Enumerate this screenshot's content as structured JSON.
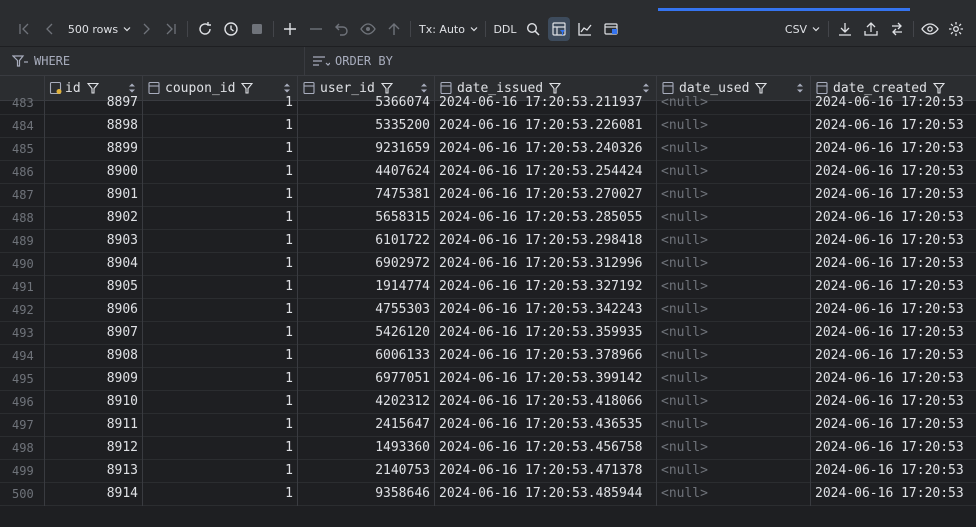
{
  "toolbar": {
    "rows_label": "500 rows",
    "tx_label": "Tx: Auto",
    "ddl_label": "DDL",
    "export_format": "CSV"
  },
  "filters": {
    "where_label": "WHERE",
    "order_by_label": "ORDER BY"
  },
  "columns": [
    {
      "name": "id"
    },
    {
      "name": "coupon_id"
    },
    {
      "name": "user_id"
    },
    {
      "name": "date_issued"
    },
    {
      "name": "date_used"
    },
    {
      "name": "date_created"
    }
  ],
  "rows": [
    {
      "num": "483",
      "id": "8897",
      "coupon_id": "1",
      "user_id": "5366074",
      "date_issued": "2024-06-16 17:20:53.211937",
      "date_used": "<null>",
      "date_created": "2024-06-16 17:20:53"
    },
    {
      "num": "484",
      "id": "8898",
      "coupon_id": "1",
      "user_id": "5335200",
      "date_issued": "2024-06-16 17:20:53.226081",
      "date_used": "<null>",
      "date_created": "2024-06-16 17:20:53"
    },
    {
      "num": "485",
      "id": "8899",
      "coupon_id": "1",
      "user_id": "9231659",
      "date_issued": "2024-06-16 17:20:53.240326",
      "date_used": "<null>",
      "date_created": "2024-06-16 17:20:53"
    },
    {
      "num": "486",
      "id": "8900",
      "coupon_id": "1",
      "user_id": "4407624",
      "date_issued": "2024-06-16 17:20:53.254424",
      "date_used": "<null>",
      "date_created": "2024-06-16 17:20:53"
    },
    {
      "num": "487",
      "id": "8901",
      "coupon_id": "1",
      "user_id": "7475381",
      "date_issued": "2024-06-16 17:20:53.270027",
      "date_used": "<null>",
      "date_created": "2024-06-16 17:20:53"
    },
    {
      "num": "488",
      "id": "8902",
      "coupon_id": "1",
      "user_id": "5658315",
      "date_issued": "2024-06-16 17:20:53.285055",
      "date_used": "<null>",
      "date_created": "2024-06-16 17:20:53"
    },
    {
      "num": "489",
      "id": "8903",
      "coupon_id": "1",
      "user_id": "6101722",
      "date_issued": "2024-06-16 17:20:53.298418",
      "date_used": "<null>",
      "date_created": "2024-06-16 17:20:53"
    },
    {
      "num": "490",
      "id": "8904",
      "coupon_id": "1",
      "user_id": "6902972",
      "date_issued": "2024-06-16 17:20:53.312996",
      "date_used": "<null>",
      "date_created": "2024-06-16 17:20:53"
    },
    {
      "num": "491",
      "id": "8905",
      "coupon_id": "1",
      "user_id": "1914774",
      "date_issued": "2024-06-16 17:20:53.327192",
      "date_used": "<null>",
      "date_created": "2024-06-16 17:20:53"
    },
    {
      "num": "492",
      "id": "8906",
      "coupon_id": "1",
      "user_id": "4755303",
      "date_issued": "2024-06-16 17:20:53.342243",
      "date_used": "<null>",
      "date_created": "2024-06-16 17:20:53"
    },
    {
      "num": "493",
      "id": "8907",
      "coupon_id": "1",
      "user_id": "5426120",
      "date_issued": "2024-06-16 17:20:53.359935",
      "date_used": "<null>",
      "date_created": "2024-06-16 17:20:53"
    },
    {
      "num": "494",
      "id": "8908",
      "coupon_id": "1",
      "user_id": "6006133",
      "date_issued": "2024-06-16 17:20:53.378966",
      "date_used": "<null>",
      "date_created": "2024-06-16 17:20:53"
    },
    {
      "num": "495",
      "id": "8909",
      "coupon_id": "1",
      "user_id": "6977051",
      "date_issued": "2024-06-16 17:20:53.399142",
      "date_used": "<null>",
      "date_created": "2024-06-16 17:20:53"
    },
    {
      "num": "496",
      "id": "8910",
      "coupon_id": "1",
      "user_id": "4202312",
      "date_issued": "2024-06-16 17:20:53.418066",
      "date_used": "<null>",
      "date_created": "2024-06-16 17:20:53"
    },
    {
      "num": "497",
      "id": "8911",
      "coupon_id": "1",
      "user_id": "2415647",
      "date_issued": "2024-06-16 17:20:53.436535",
      "date_used": "<null>",
      "date_created": "2024-06-16 17:20:53"
    },
    {
      "num": "498",
      "id": "8912",
      "coupon_id": "1",
      "user_id": "1493360",
      "date_issued": "2024-06-16 17:20:53.456758",
      "date_used": "<null>",
      "date_created": "2024-06-16 17:20:53"
    },
    {
      "num": "499",
      "id": "8913",
      "coupon_id": "1",
      "user_id": "2140753",
      "date_issued": "2024-06-16 17:20:53.471378",
      "date_used": "<null>",
      "date_created": "2024-06-16 17:20:53"
    },
    {
      "num": "500",
      "id": "8914",
      "coupon_id": "1",
      "user_id": "9358646",
      "date_issued": "2024-06-16 17:20:53.485944",
      "date_used": "<null>",
      "date_created": "2024-06-16 17:20:53"
    }
  ]
}
